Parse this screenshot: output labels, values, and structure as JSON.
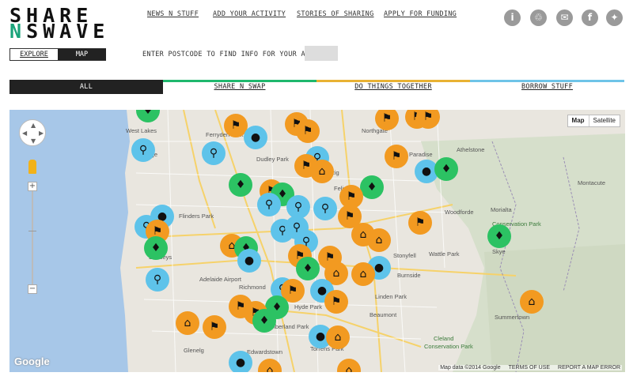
{
  "logo": {
    "line1": "SHARE",
    "line2_n": "N",
    "line2_rest": "SWAVE"
  },
  "nav": [
    {
      "label": "NEWS N STUFF"
    },
    {
      "label": "ADD YOUR ACTIVITY"
    },
    {
      "label": "STORIES OF SHARING"
    },
    {
      "label": "APPLY FOR FUNDING"
    }
  ],
  "social": [
    {
      "icon": "info-icon",
      "glyph": "i"
    },
    {
      "icon": "share-logo-icon",
      "glyph": "♲"
    },
    {
      "icon": "mail-icon",
      "glyph": "✉"
    },
    {
      "icon": "facebook-icon",
      "glyph": "f"
    },
    {
      "icon": "twitter-icon",
      "glyph": "✦"
    }
  ],
  "toggle": {
    "explore": "EXPLORE",
    "map": "MAP"
  },
  "postcode": {
    "label": "ENTER POSTCODE TO FIND INFO FOR YOUR AREA",
    "placeholder": ""
  },
  "tabs": [
    {
      "label": "ALL",
      "color": "#222222"
    },
    {
      "label": "SHARE N SWAP",
      "color": "#1fb86d"
    },
    {
      "label": "DO THINGS TOGETHER",
      "color": "#e9b233"
    },
    {
      "label": "BORROW STUFF",
      "color": "#6ec4e8"
    }
  ],
  "map": {
    "type_map": "Map",
    "type_satellite": "Satellite",
    "google": "Google",
    "attribution": "Map data ©2014 Google",
    "terms": "TERMS OF USE",
    "report": "REPORT A MAP ERROR",
    "colors": {
      "share": "#2cc263",
      "together": "#f29a21",
      "borrow": "#5ec3ea"
    }
  }
}
